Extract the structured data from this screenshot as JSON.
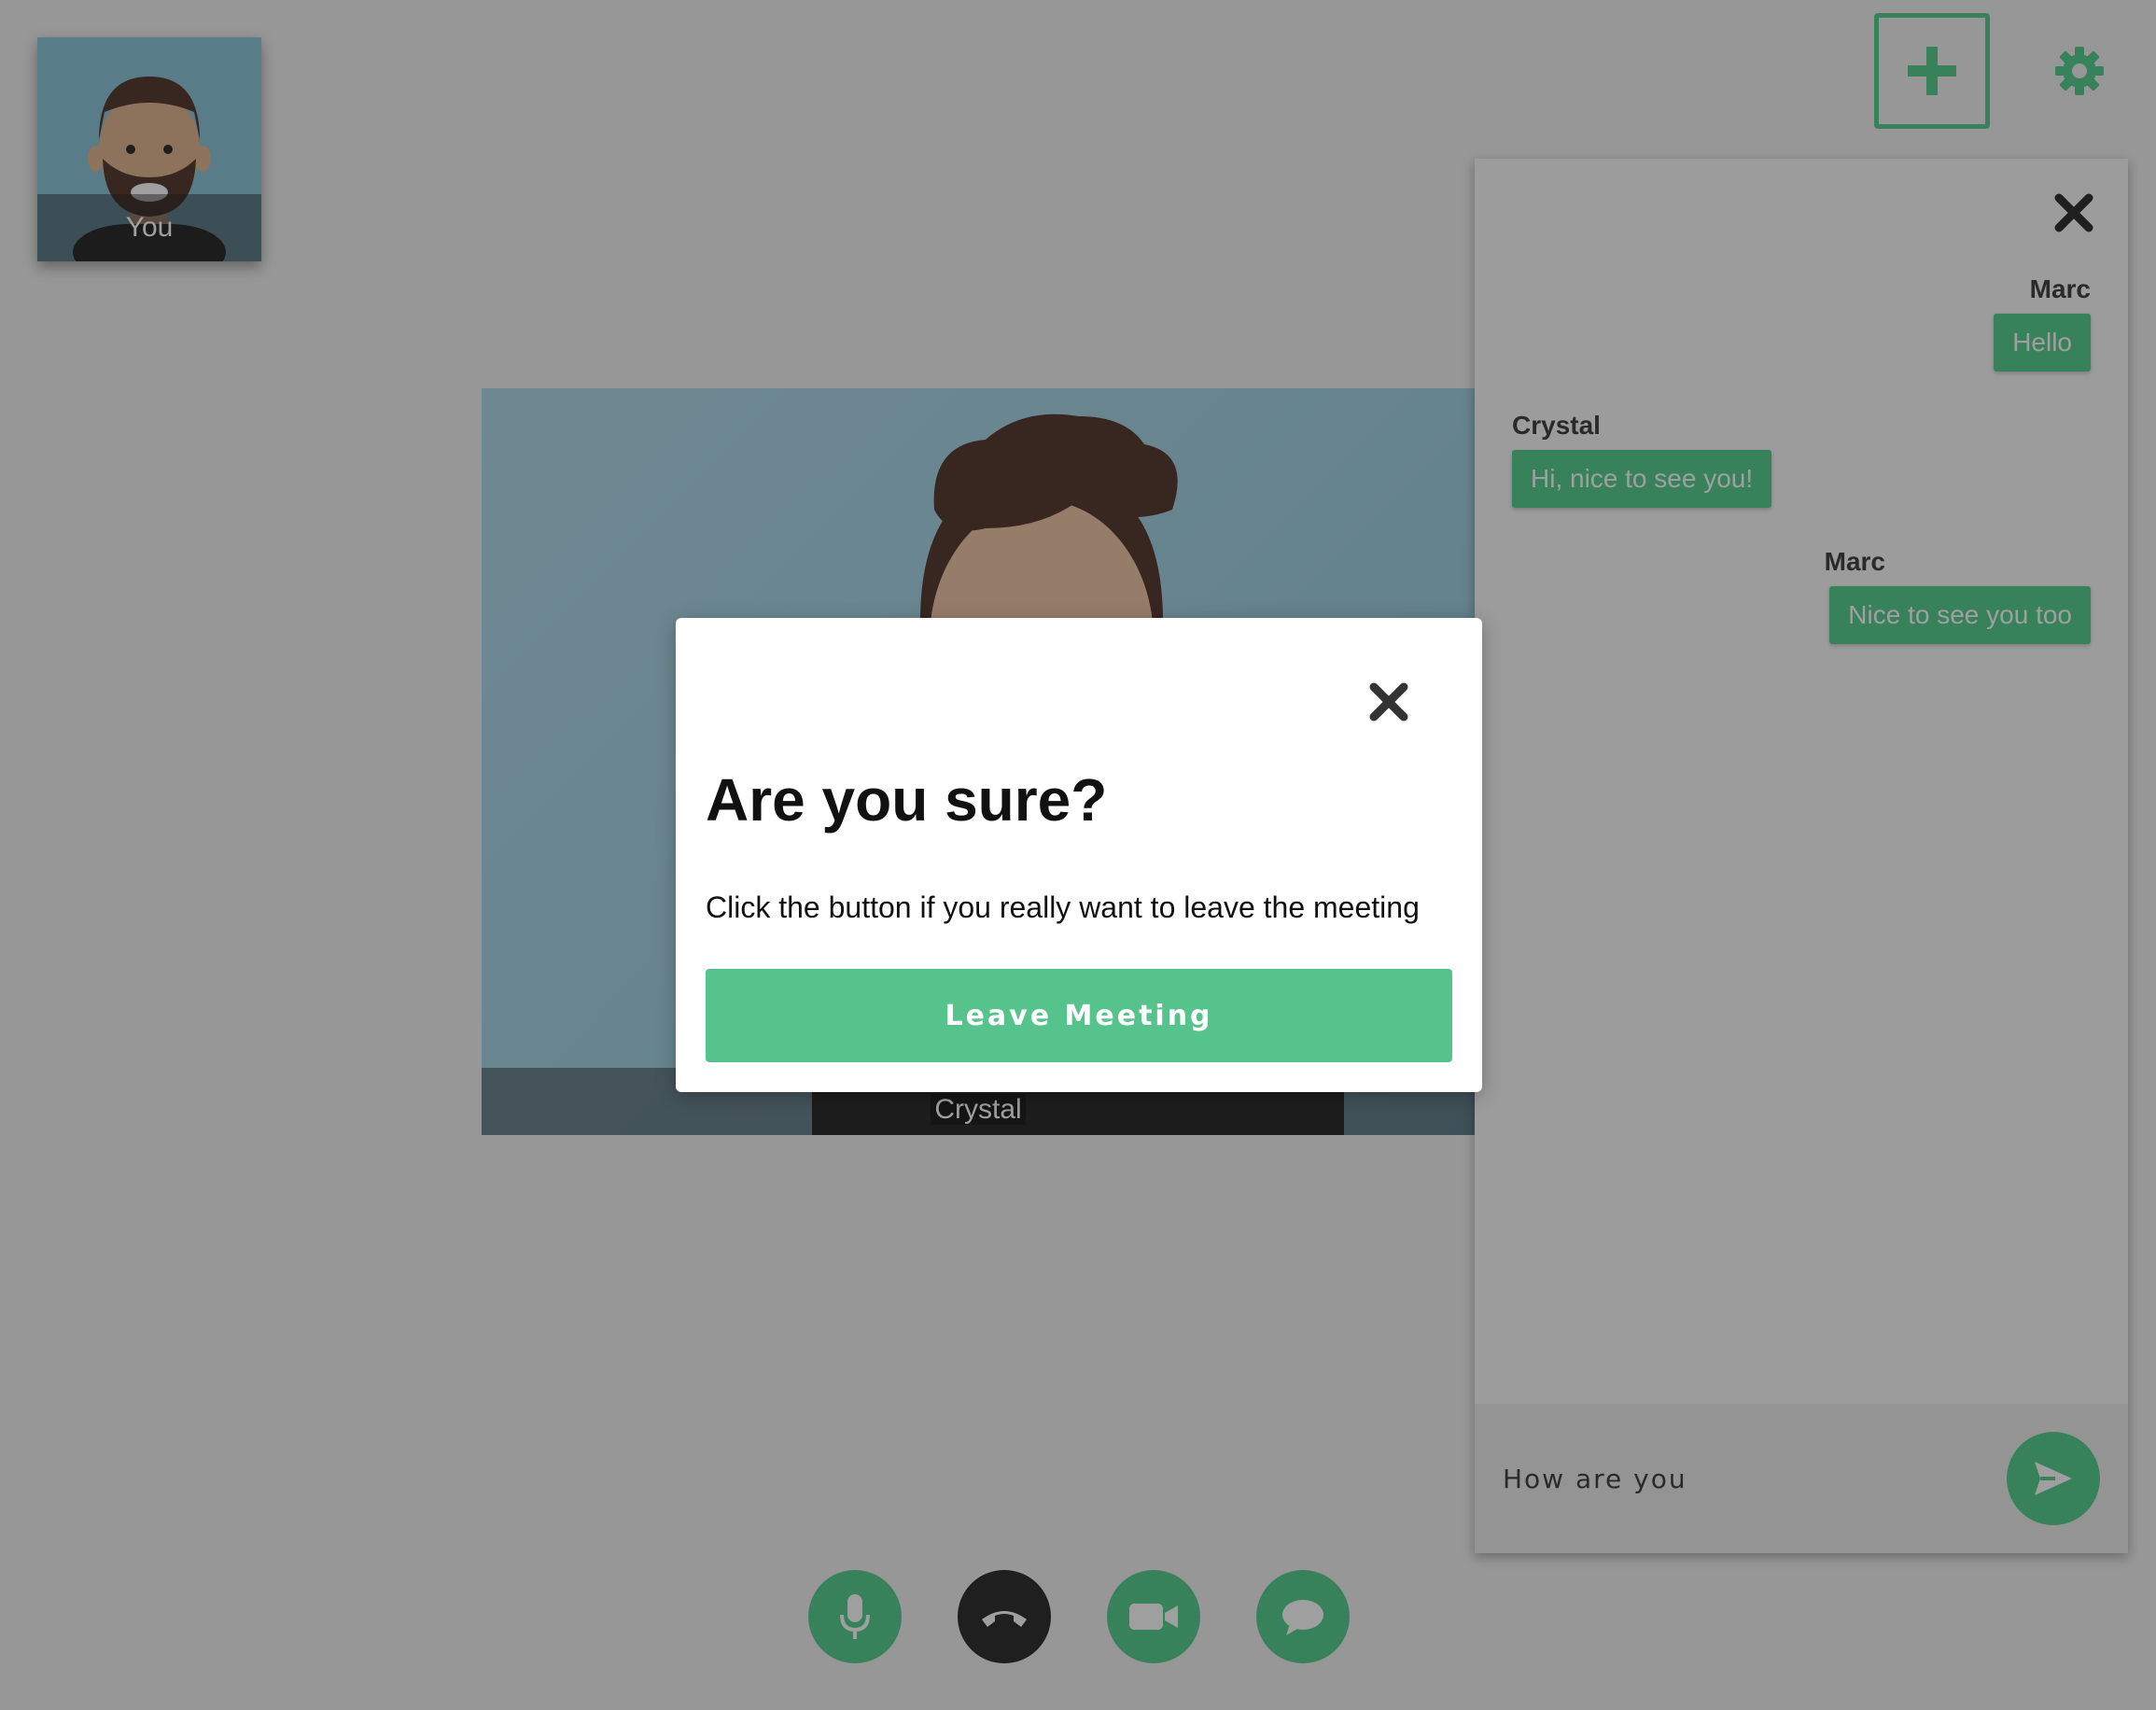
{
  "colors": {
    "accent": "#5bd193",
    "hangup": "#333333",
    "modal_button": "#57c38c",
    "overlay": "rgba(0,0,0,0.375)"
  },
  "self_video": {
    "label": "You"
  },
  "main_video": {
    "participant": "Crystal"
  },
  "top_actions": {
    "add_icon": "plus-icon",
    "settings_icon": "gear-icon"
  },
  "chat": {
    "close_icon": "close-icon",
    "messages": [
      {
        "sender": "Marc",
        "text": "Hello",
        "own": true
      },
      {
        "sender": "Crystal",
        "text": "Hi, nice to see you!",
        "own": false
      },
      {
        "sender": "Marc",
        "text": "Nice to see you too",
        "own": true
      }
    ],
    "input_value": "How are you",
    "send_icon": "send-icon"
  },
  "controls": [
    {
      "name": "mic",
      "icon": "microphone-icon"
    },
    {
      "name": "hangup",
      "icon": "phone-hangup-icon"
    },
    {
      "name": "camera",
      "icon": "video-camera-icon"
    },
    {
      "name": "chat",
      "icon": "chat-bubble-icon"
    }
  ],
  "modal": {
    "title": "Are you sure?",
    "text": "Click the button if you really want to leave the meeting",
    "button_label": "Leave Meeting",
    "close_icon": "close-icon"
  }
}
